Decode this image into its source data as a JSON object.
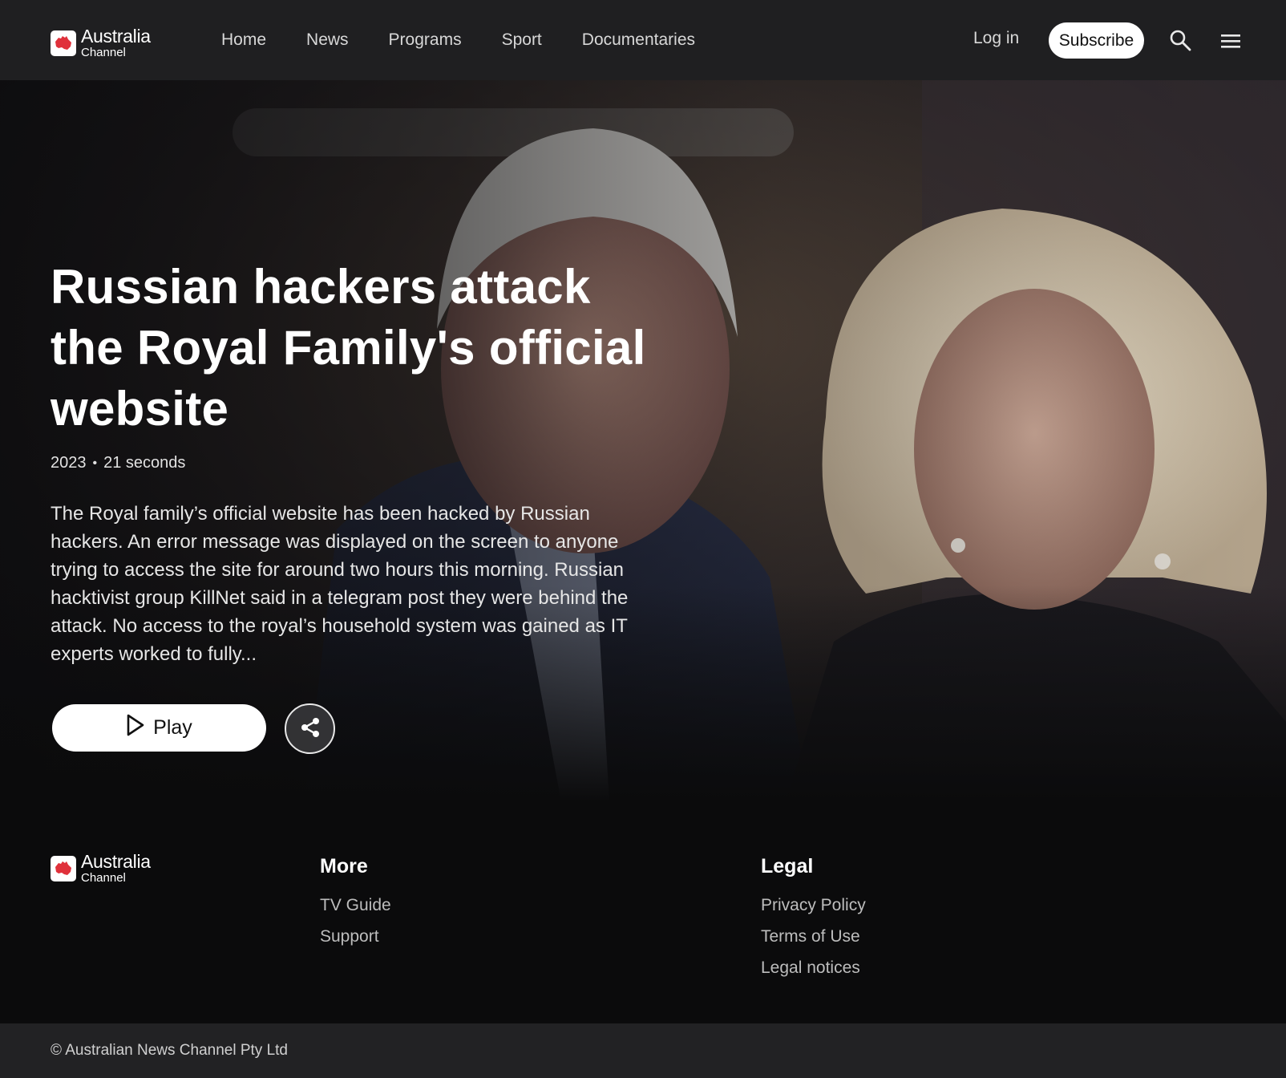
{
  "brand": {
    "line1": "Australia",
    "line2": "Channel",
    "accent": "#e0313b"
  },
  "nav": {
    "items": [
      "Home",
      "News",
      "Programs",
      "Sport",
      "Documentaries"
    ],
    "login": "Log in",
    "subscribe": "Subscribe"
  },
  "hero": {
    "title": "Russian hackers attack the Royal Family's official website",
    "year": "2023",
    "separator": "•",
    "duration": "21 seconds",
    "description": "The Royal family’s official website has been hacked by Russian hackers. An error message was displayed on the screen to anyone trying to access the site for around two hours this morning. Russian hacktivist group KillNet said in a telegram post they were behind the attack. No access to the royal’s household system was gained as IT experts worked to fully...",
    "play_label": "Play"
  },
  "footer": {
    "more": {
      "heading": "More",
      "links": [
        "TV Guide",
        "Support"
      ]
    },
    "legal": {
      "heading": "Legal",
      "links": [
        "Privacy Policy",
        "Terms of Use",
        "Legal notices"
      ]
    },
    "copyright": "© Australian News Channel Pty Ltd"
  }
}
